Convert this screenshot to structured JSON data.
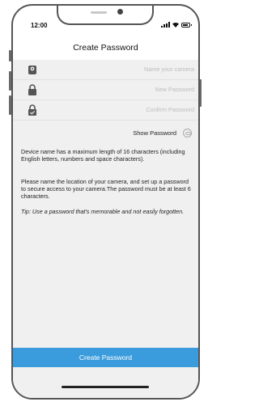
{
  "status": {
    "time": "12:00"
  },
  "header": {
    "title": "Create Password"
  },
  "form": {
    "fields": [
      {
        "placeholder": "Name your camera",
        "icon": "camera-icon"
      },
      {
        "placeholder": "New Password",
        "icon": "lock-icon"
      },
      {
        "placeholder": "Confirm Password",
        "icon": "lock-check-icon"
      }
    ],
    "show_password_label": "Show Password"
  },
  "info": {
    "p1": "Device name has a maximum length of 16 characters (including English letters, numbers and space characters).",
    "p2": "Please name the location of your camera, and set up a password to secure access to your camera.The password must be at least 6 characters.",
    "tip": "Tip: Use a password that's memorable and not easily forgotten."
  },
  "cta": {
    "label": "Create Password"
  },
  "colors": {
    "accent": "#3a9cdc",
    "background": "#f0f0f0"
  }
}
